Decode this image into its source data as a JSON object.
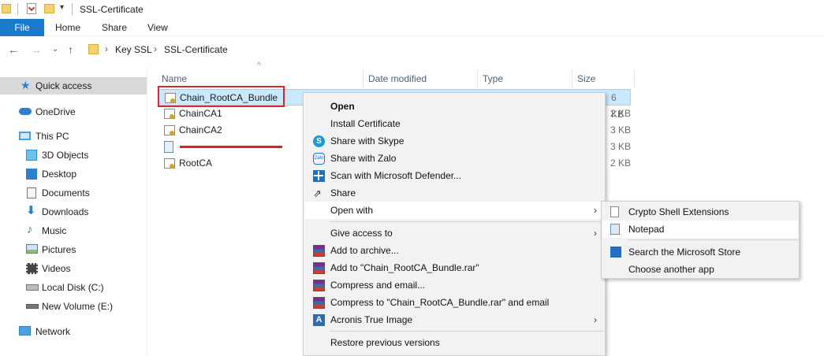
{
  "window": {
    "title": "SSL-Certificate"
  },
  "ribbon": {
    "file": "File",
    "home": "Home",
    "share": "Share",
    "view": "View"
  },
  "address": {
    "crumbs": [
      "Key SSL",
      "SSL-Certificate"
    ],
    "separator": "›"
  },
  "nav": {
    "quick_access": "Quick access",
    "onedrive": "OneDrive",
    "this_pc": "This PC",
    "objects3d": "3D Objects",
    "desktop": "Desktop",
    "documents": "Documents",
    "downloads": "Downloads",
    "music": "Music",
    "pictures": "Pictures",
    "videos": "Videos",
    "local_disk": "Local Disk (C:)",
    "new_volume": "New Volume (E:)",
    "network": "Network"
  },
  "columns": {
    "name": "Name",
    "date_modified": "Date modified",
    "type": "Type",
    "size": "Size"
  },
  "files": [
    {
      "name": "Chain_RootCA_Bundle",
      "size": "6 KB"
    },
    {
      "name": "ChainCA1",
      "size": "2 KB"
    },
    {
      "name": "ChainCA2",
      "size": "3 KB"
    },
    {
      "name": "",
      "size": "3 KB"
    },
    {
      "name": "RootCA",
      "size": "2 KB"
    }
  ],
  "context_menu": {
    "open": "Open",
    "install_certificate": "Install Certificate",
    "share_skype": "Share with Skype",
    "share_zalo": "Share with Zalo",
    "scan_defender": "Scan with Microsoft Defender...",
    "share": "Share",
    "open_with": "Open with",
    "give_access": "Give access to",
    "add_archive": "Add to archive...",
    "add_rar": "Add to \"Chain_RootCA_Bundle.rar\"",
    "compress_email": "Compress and email...",
    "compress_rar_email": "Compress to \"Chain_RootCA_Bundle.rar\" and email",
    "acronis": "Acronis True Image",
    "restore": "Restore previous versions"
  },
  "submenu": {
    "crypto_shell": "Crypto Shell Extensions",
    "notepad": "Notepad",
    "ms_store": "Search the Microsoft Store",
    "choose_app": "Choose another app"
  },
  "colors": {
    "accent": "#1979ca",
    "selection": "#cce8ff",
    "highlight_border": "#d12b2b"
  }
}
